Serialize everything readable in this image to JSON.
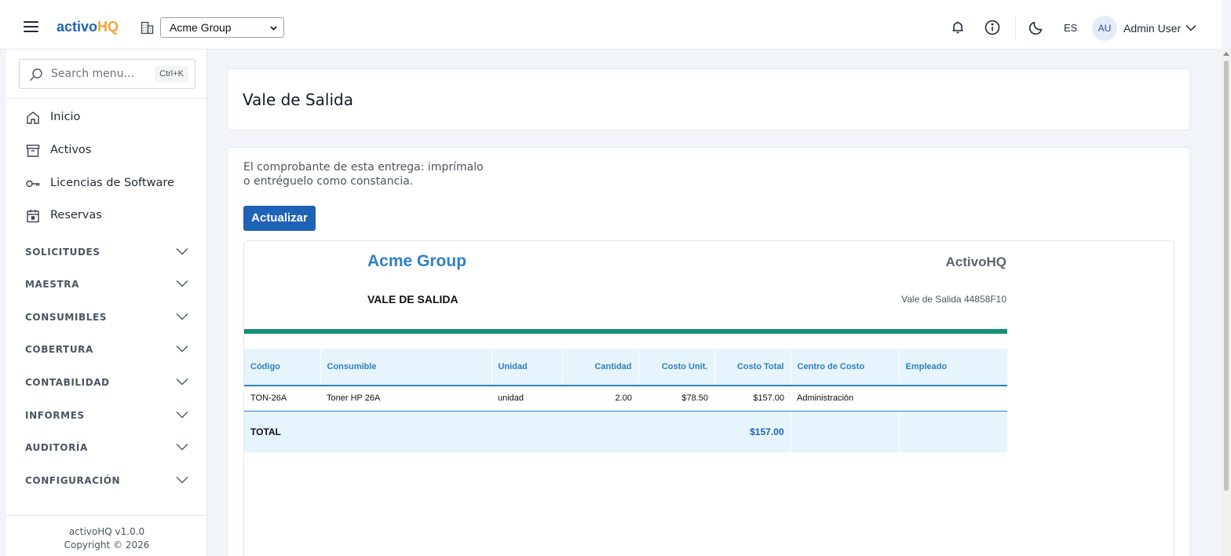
{
  "header": {
    "logo_part1": "activo",
    "logo_part2": "HQ",
    "company_selected": "Acme Group",
    "language": "ES",
    "avatar_initials": "AU",
    "user_name": "Admin User"
  },
  "sidebar": {
    "search_placeholder": "Search menu...",
    "search_shortcut": "Ctrl+K",
    "nav": [
      {
        "label": "Inicio",
        "icon": "home-icon"
      },
      {
        "label": "Activos",
        "icon": "archive-box-icon"
      },
      {
        "label": "Licencias de Software",
        "icon": "key-icon"
      },
      {
        "label": "Reservas",
        "icon": "calendar-icon"
      }
    ],
    "sections": [
      {
        "label": "SOLICITUDES"
      },
      {
        "label": "MAESTRA"
      },
      {
        "label": "CONSUMIBLES"
      },
      {
        "label": "COBERTURA"
      },
      {
        "label": "CONTABILIDAD"
      },
      {
        "label": "INFORMES"
      },
      {
        "label": "AUDITORÍA"
      },
      {
        "label": "CONFIGURACIÓN"
      }
    ],
    "version": "activoHQ v1.0.0",
    "copyright": "Copyright © 2026"
  },
  "page": {
    "title": "Vale de Salida",
    "description": "El comprobante de esta entrega: imprímalo o entréguelo como constancia.",
    "refresh_button": "Actualizar"
  },
  "voucher": {
    "company": "Acme Group",
    "brand": "ActivoHQ",
    "doc_title": "VALE DE SALIDA",
    "doc_number": "Vale de Salida 44858F10",
    "accent_color": "#13907a",
    "columns": {
      "code": "Código",
      "consumable": "Consumible",
      "unit": "Unidad",
      "quantity": "Cantidad",
      "unit_cost": "Costo Unit.",
      "total_cost": "Costo Total",
      "cost_center": "Centro de Costo",
      "employee": "Empleado"
    },
    "rows": [
      {
        "code": "TON-26A",
        "consumable": "Toner HP 26A",
        "unit": "unidad",
        "quantity": "2.00",
        "unit_cost": "$78.50",
        "total_cost": "$157.00",
        "cost_center": "Administración",
        "employee": ""
      }
    ],
    "total_label": "TOTAL",
    "total_value": "$157.00"
  }
}
